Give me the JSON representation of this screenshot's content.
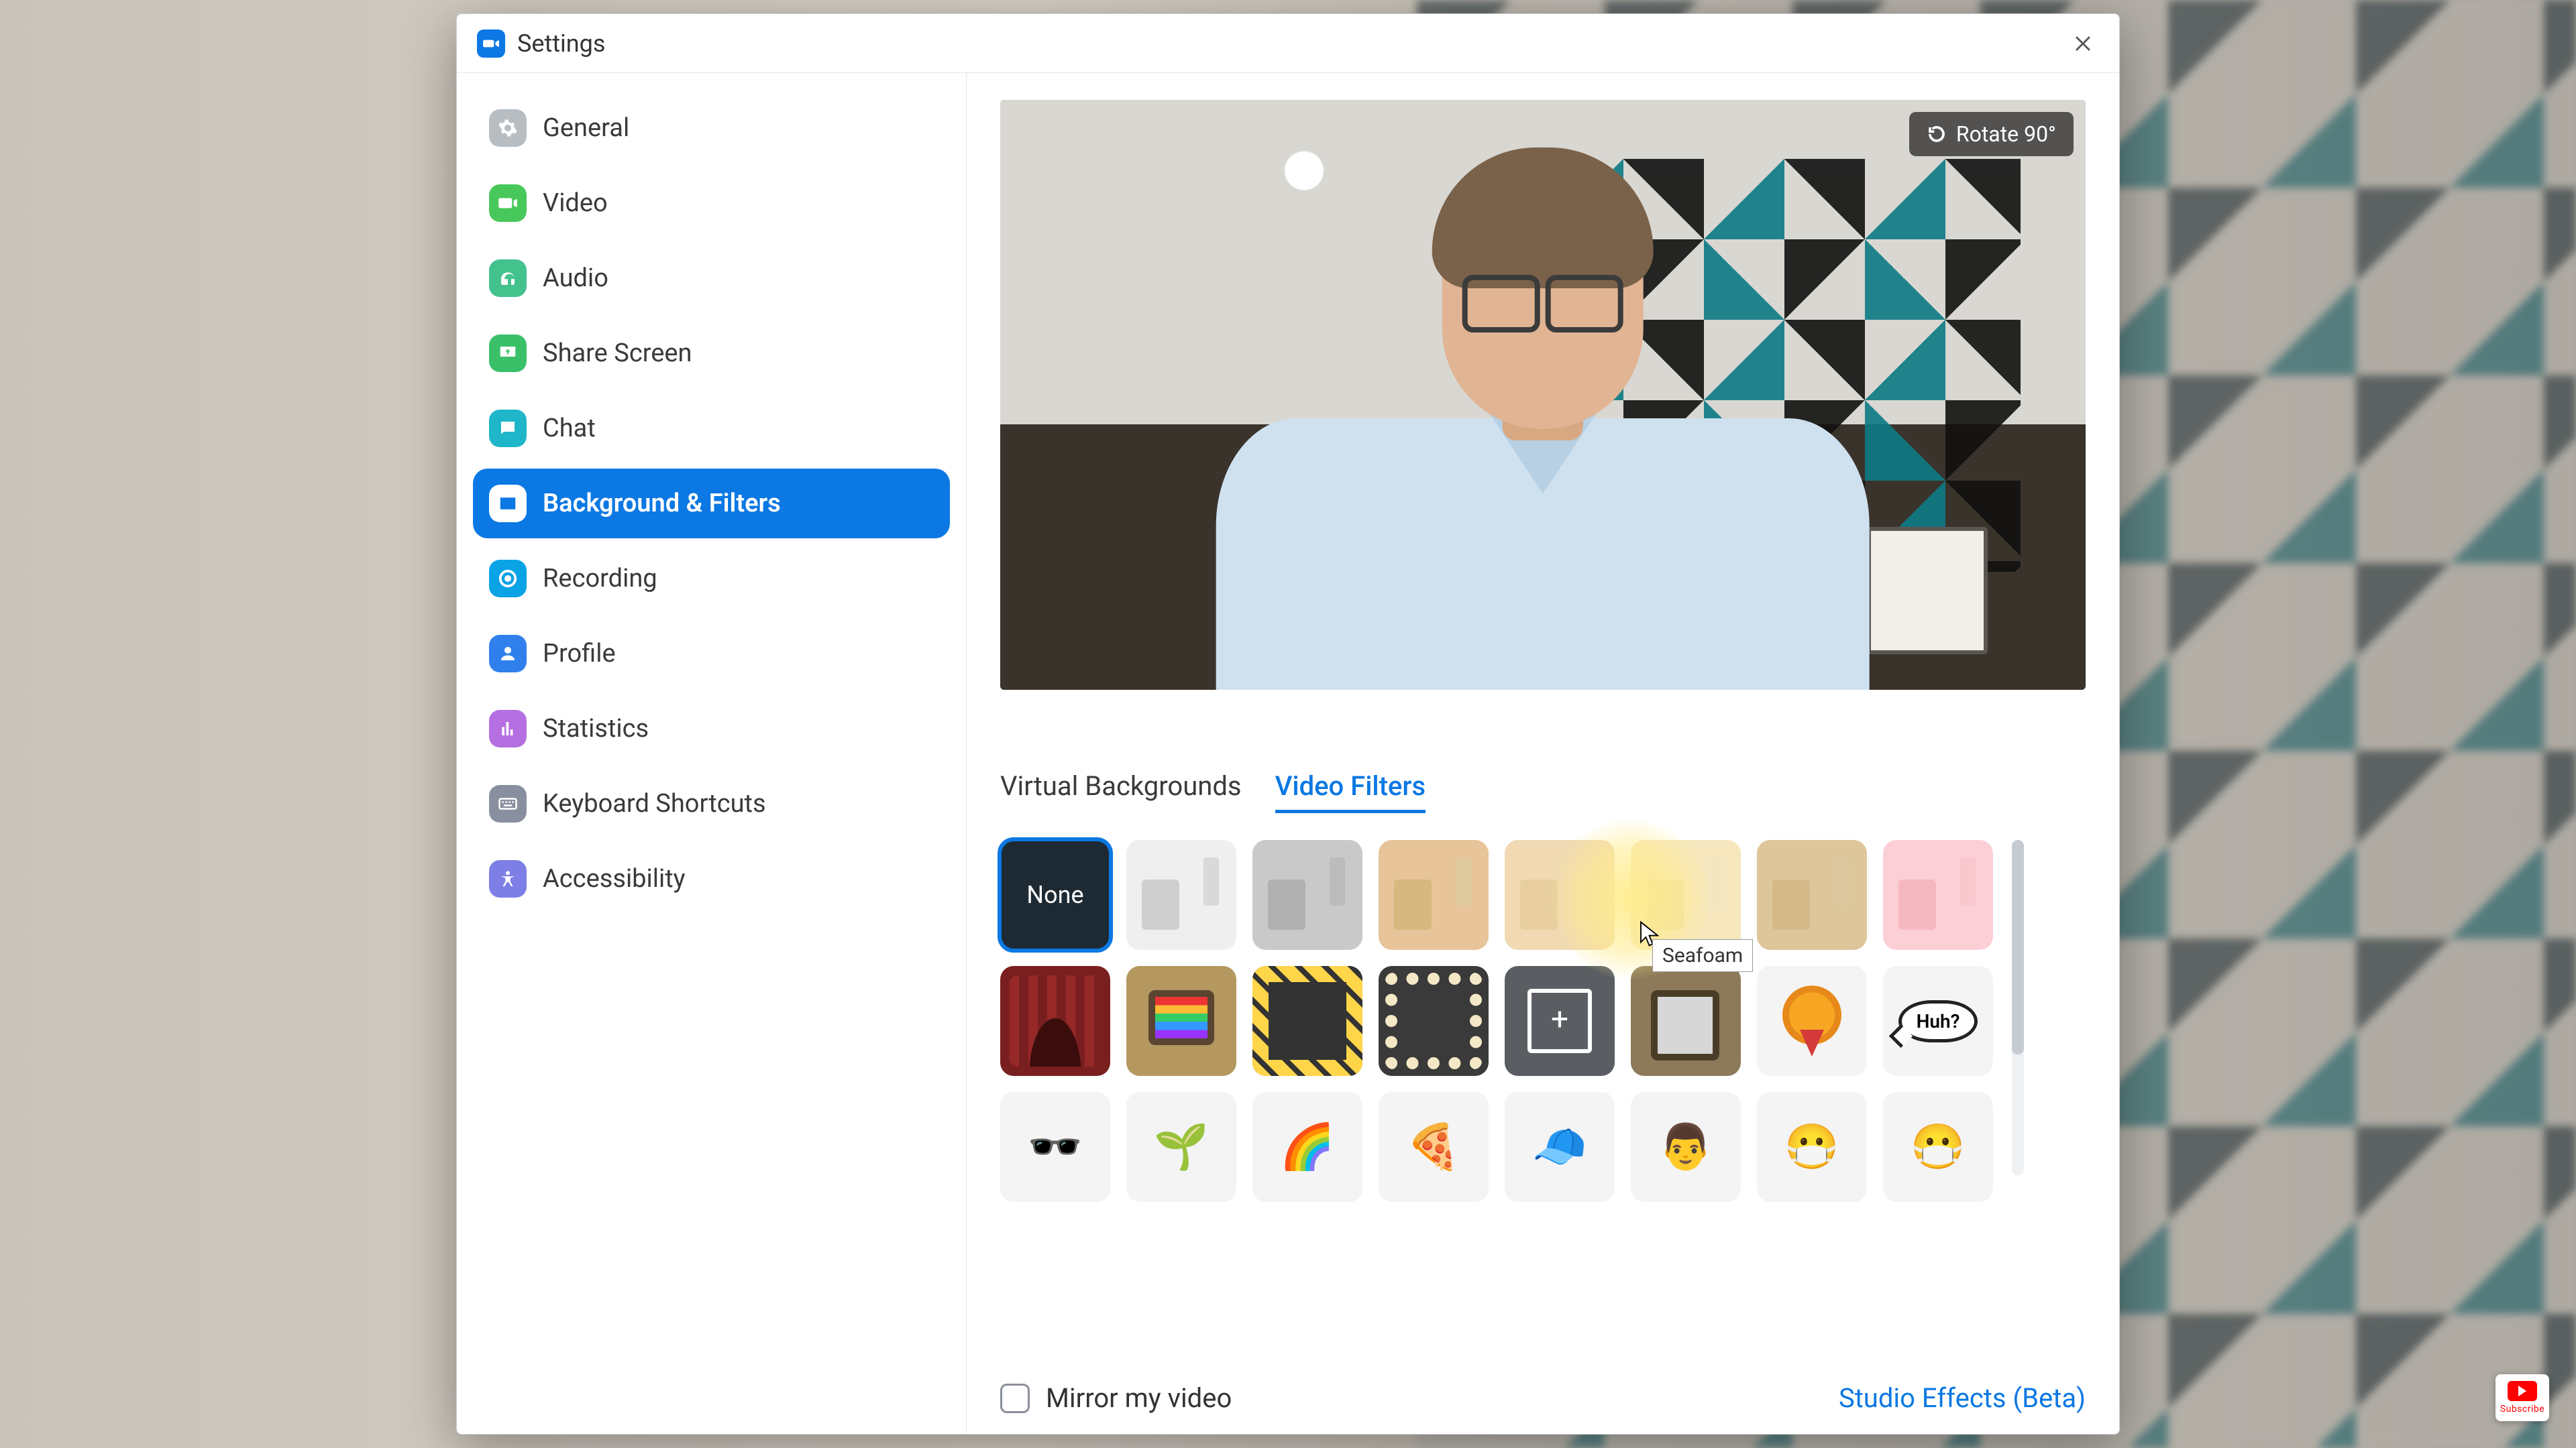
{
  "window": {
    "title": "Settings"
  },
  "sidebar": {
    "items": [
      {
        "label": "General"
      },
      {
        "label": "Video"
      },
      {
        "label": "Audio"
      },
      {
        "label": "Share Screen"
      },
      {
        "label": "Chat"
      },
      {
        "label": "Background & Filters"
      },
      {
        "label": "Recording"
      },
      {
        "label": "Profile"
      },
      {
        "label": "Statistics"
      },
      {
        "label": "Keyboard Shortcuts"
      },
      {
        "label": "Accessibility"
      }
    ],
    "active_index": 5
  },
  "preview": {
    "rotate_label": "Rotate 90°"
  },
  "tabs": {
    "virtual_backgrounds": "Virtual Backgrounds",
    "video_filters": "Video Filters",
    "active": "video_filters"
  },
  "filters": {
    "none_label": "None",
    "hover_tooltip": "Seafoam",
    "huh_text": "Huh?"
  },
  "footer": {
    "mirror_label": "Mirror my video",
    "mirror_checked": false,
    "studio_effects": "Studio Effects (Beta)"
  },
  "yt": {
    "subscribe": "Subscribe"
  }
}
